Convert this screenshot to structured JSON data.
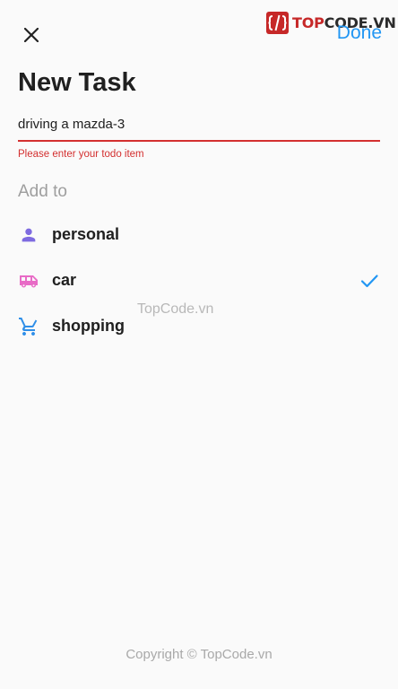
{
  "app_bar": {
    "close_icon": "close-icon",
    "done_label": "Done",
    "logo": {
      "brand_top": "TOP",
      "brand_rest": "CODE.VN"
    }
  },
  "page": {
    "title": "New Task"
  },
  "task_field": {
    "value": "driving a mazda-3",
    "error": "Please enter your todo item"
  },
  "add_to": {
    "heading": "Add to",
    "items": [
      {
        "label": "personal",
        "icon": "person-icon",
        "color": "#7e6be0",
        "selected": false
      },
      {
        "label": "car",
        "icon": "van-icon",
        "color": "#e86bc6",
        "selected": true
      },
      {
        "label": "shopping",
        "icon": "cart-icon",
        "color": "#2f8fe8",
        "selected": false
      }
    ],
    "check_color": "#2196f3"
  },
  "watermark": "TopCode.vn",
  "footer": {
    "copyright": "Copyright © TopCode.vn"
  }
}
